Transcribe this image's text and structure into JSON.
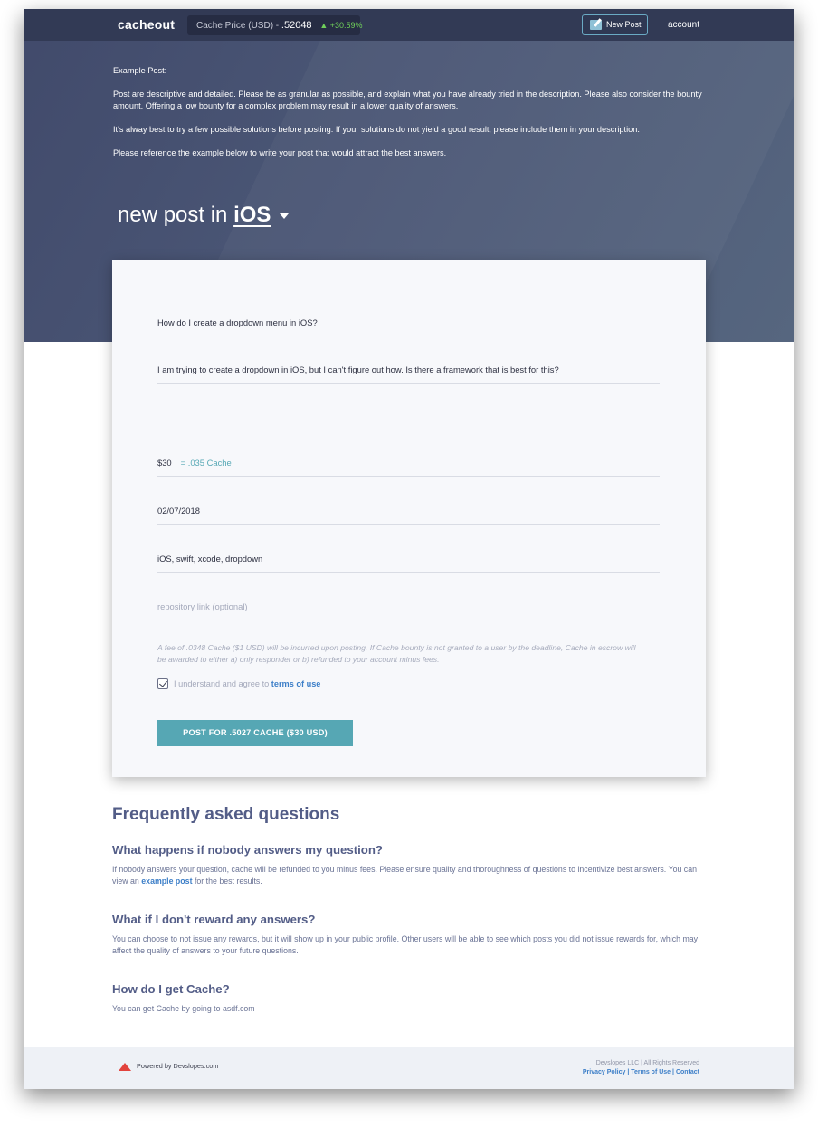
{
  "navbar": {
    "brand": "cacheout",
    "price_label": "Cache Price (USD) - ",
    "price_value": ".52048",
    "price_change": "+30.59%",
    "new_post_label": "New Post",
    "account_label": "account"
  },
  "intro": {
    "heading": "Example Post:",
    "para1": "Post are descriptive and detailed. Please be as granular as possible, and explain what you have already tried in the description. Please also consider the bounty amount. Offering a low bounty for a complex problem may result in a lower quality of answers.",
    "para2": "It's alway best to try a few possible solutions before posting. If your solutions do not yield a good result, please include them in your description.",
    "para3": "Please reference the example below to write your post that would attract the best answers."
  },
  "title": {
    "prefix": "new post in ",
    "category": "iOS"
  },
  "form": {
    "question": "How do I create a dropdown menu in iOS?",
    "description": "I am trying to create a dropdown in iOS, but I can't figure out how. Is there a framework that is best for this?",
    "bounty_usd": "$30",
    "bounty_cache": "= .035 Cache",
    "deadline": "02/07/2018",
    "tags": "iOS, swift, xcode, dropdown",
    "repo_placeholder": "repository link (optional)",
    "fee_notice": "A fee of .0348 Cache ($1 USD) will be incurred upon posting. If Cache bounty is not granted to a user by the deadline, Cache in escrow will be awarded to either a) only responder or b) refunded to your account minus fees.",
    "agree_text": "I understand and agree to ",
    "terms_link": "terms of use",
    "submit_label": "POST FOR .5027 CACHE ($30 USD)"
  },
  "faq": {
    "title": "Frequently asked questions",
    "q1": "What happens if nobody answers my question?",
    "a1_before": "If nobody answers your question, cache will be refunded to you minus fees. Please ensure quality and thoroughness of questions to incentivize best answers. You can view an ",
    "a1_link": "example post",
    "a1_after": " for the best results.",
    "q2": "What if I don't reward any answers?",
    "a2": "You can choose to not issue any rewards, but it will show up in your public profile. Other users will be able to see which posts you did not issue rewards for, which may affect the quality of answers to your future questions.",
    "q3": "How do I get Cache?",
    "a3": "You can get Cache by going to asdf.com"
  },
  "footer": {
    "powered": "Powered by Devslopes.com",
    "rights": "Devslopes LLC | All Rights Reserved",
    "privacy": "Privacy Policy",
    "sep": " | ",
    "terms": "Terms of Use",
    "contact": "Contact"
  },
  "colors": {
    "accent": "#56a7b4",
    "link": "#3d7fc8",
    "nav_bg": "#323a55",
    "price_up": "#6fce5a"
  }
}
